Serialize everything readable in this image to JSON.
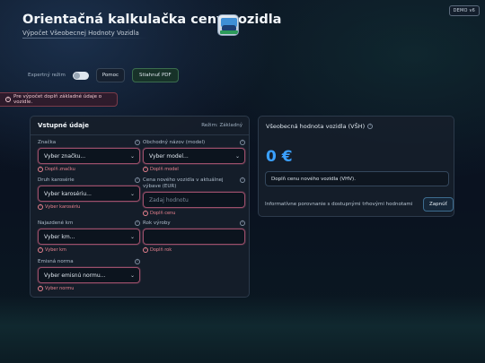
{
  "badge": "DEMO v6",
  "header": {
    "title": "Orientačná kalkulačka ceny vozidla",
    "subtitle": "Výpočet Všeobecnej Hodnoty Vozidla"
  },
  "toolbar": {
    "expert_label": "Expertný režim",
    "help_label": "Pomoc",
    "pdf_label": "Stiahnuť PDF"
  },
  "alert": {
    "text": "Pre výpočet doplň základné údaje o vozidle."
  },
  "form": {
    "title": "Vstupné údaje",
    "mode": "Režim: Základný",
    "fields": [
      {
        "label": "Značka",
        "value": "Vyber značku...",
        "error": "Doplň značku"
      },
      {
        "label": "Obchodný názov (model)",
        "value": "Vyber model...",
        "error": "Doplň model"
      },
      {
        "label": "Druh karosérie",
        "value": "Vyber karosériu...",
        "error": "Vyber karosériu"
      },
      {
        "label": "Cena nového vozidla v aktuálnej výbave (EUR)",
        "placeholder": "Zadaj hodnotu",
        "error": "Doplň cenu"
      },
      {
        "label": "Najazdené km",
        "value": "Vyber km...",
        "error": "Vyber km"
      },
      {
        "label": "Rok výroby",
        "value": "",
        "error": "Doplň rok"
      },
      {
        "label": "Emisná norma",
        "value": "Vyber emisnú normu...",
        "error": "Vyber normu"
      }
    ]
  },
  "result": {
    "title": "Všeobecná hodnota vozidla (VŠH)",
    "value": "0 €",
    "note": "Doplň cenu nového vozidla (VHV).",
    "compare_text": "Informatívne porovnanie s dostupnými trhovými hodnotami",
    "compare_button": "Zapnúť"
  },
  "icons": {
    "info": "info-icon",
    "chevron": "chevron-down-icon",
    "logo": "car-app-logo"
  },
  "colors": {
    "accent": "#3aa0ff",
    "error": "#e9828f",
    "invalid_border": "#9b4f6b"
  }
}
